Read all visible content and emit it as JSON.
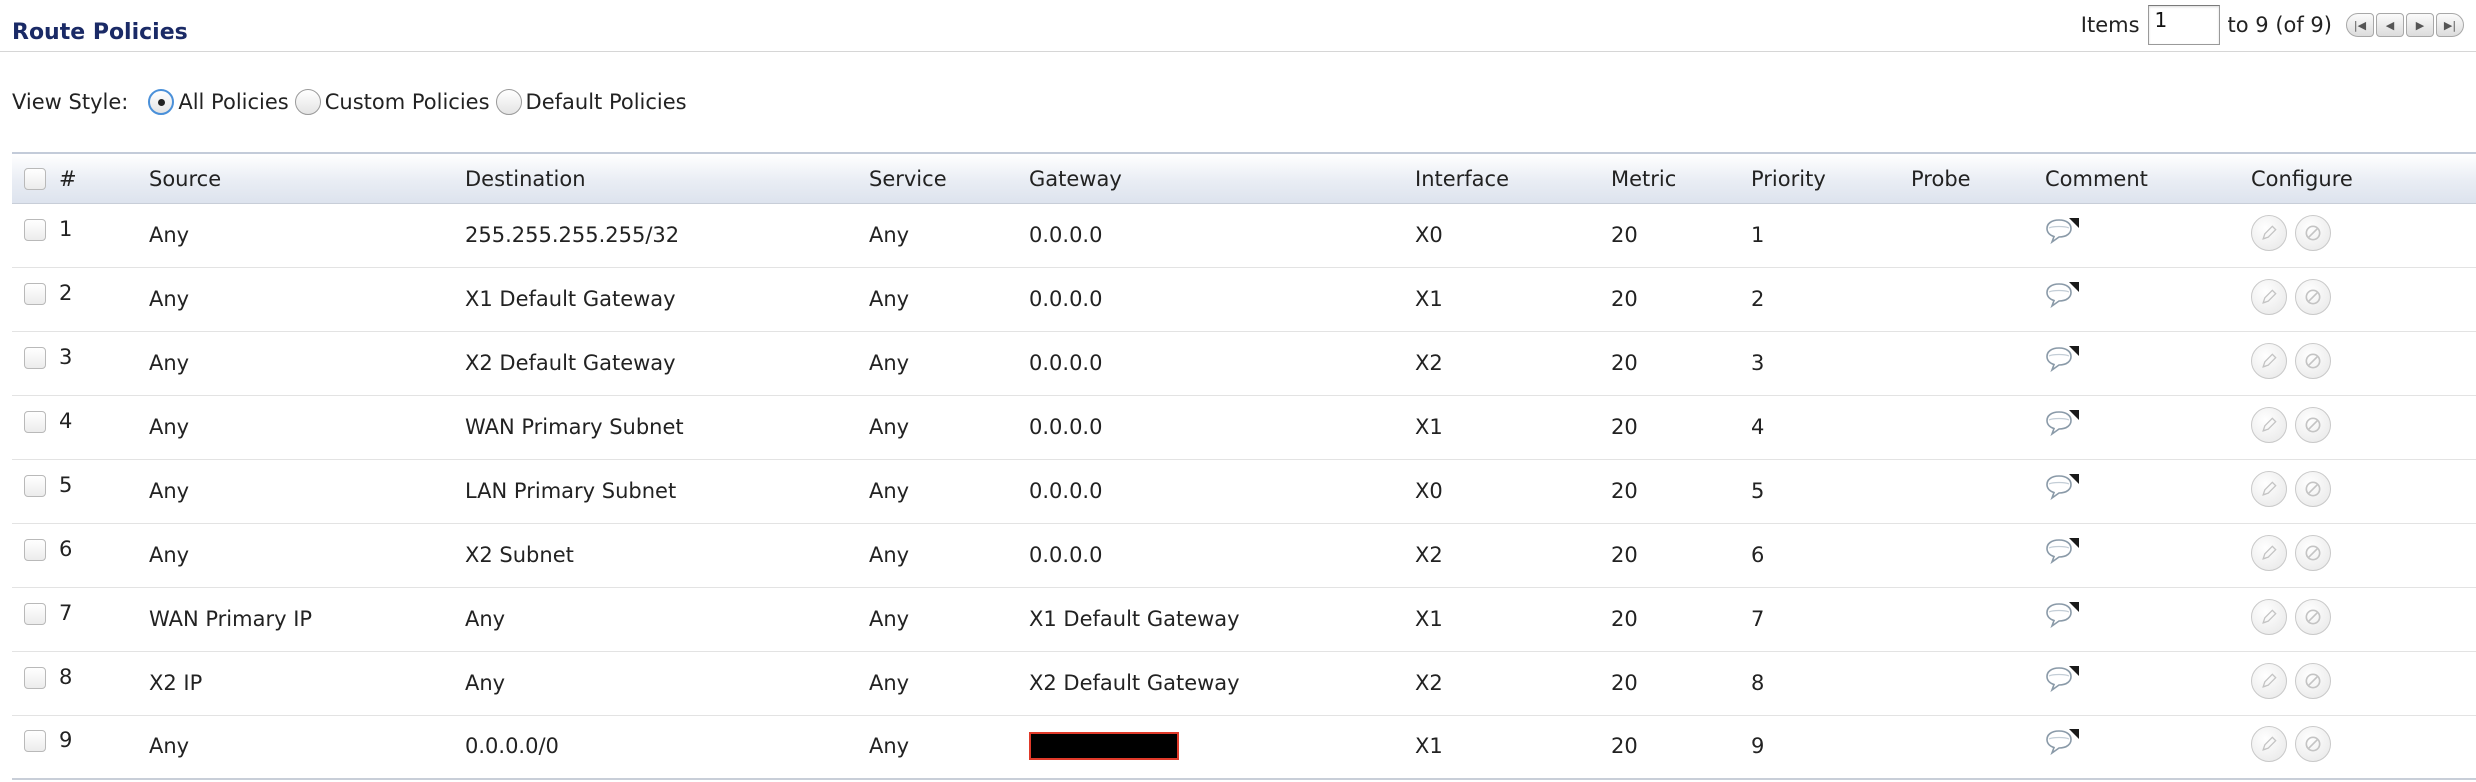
{
  "header": {
    "title": "Route Policies",
    "items_label": "Items",
    "items_value": "1",
    "range_text": "to 9 (of 9)"
  },
  "view_style": {
    "label": "View Style:",
    "options": [
      "All Policies",
      "Custom Policies",
      "Default Policies"
    ],
    "selected": "All Policies"
  },
  "table": {
    "columns": [
      "#",
      "Source",
      "Destination",
      "Service",
      "Gateway",
      "Interface",
      "Metric",
      "Priority",
      "Probe",
      "Comment",
      "Configure"
    ],
    "rows": [
      {
        "num": "1",
        "source": "Any",
        "destination": "255.255.255.255/32",
        "service": "Any",
        "gateway": "0.0.0.0",
        "interface": "X0",
        "metric": "20",
        "priority": "1",
        "probe": ""
      },
      {
        "num": "2",
        "source": "Any",
        "destination": "X1 Default Gateway",
        "service": "Any",
        "gateway": "0.0.0.0",
        "interface": "X1",
        "metric": "20",
        "priority": "2",
        "probe": ""
      },
      {
        "num": "3",
        "source": "Any",
        "destination": "X2 Default Gateway",
        "service": "Any",
        "gateway": "0.0.0.0",
        "interface": "X2",
        "metric": "20",
        "priority": "3",
        "probe": ""
      },
      {
        "num": "4",
        "source": "Any",
        "destination": "WAN Primary Subnet",
        "service": "Any",
        "gateway": "0.0.0.0",
        "interface": "X1",
        "metric": "20",
        "priority": "4",
        "probe": ""
      },
      {
        "num": "5",
        "source": "Any",
        "destination": "LAN Primary Subnet",
        "service": "Any",
        "gateway": "0.0.0.0",
        "interface": "X0",
        "metric": "20",
        "priority": "5",
        "probe": ""
      },
      {
        "num": "6",
        "source": "Any",
        "destination": "X2 Subnet",
        "service": "Any",
        "gateway": "0.0.0.0",
        "interface": "X2",
        "metric": "20",
        "priority": "6",
        "probe": ""
      },
      {
        "num": "7",
        "source": "WAN Primary IP",
        "destination": "Any",
        "service": "Any",
        "gateway": "X1 Default Gateway",
        "interface": "X1",
        "metric": "20",
        "priority": "7",
        "probe": ""
      },
      {
        "num": "8",
        "source": "X2 IP",
        "destination": "Any",
        "service": "Any",
        "gateway": "X2 Default Gateway",
        "interface": "X2",
        "metric": "20",
        "priority": "8",
        "probe": ""
      },
      {
        "num": "9",
        "source": "Any",
        "destination": "0.0.0.0/0",
        "service": "Any",
        "gateway": "",
        "gateway_redacted": true,
        "interface": "X1",
        "metric": "20",
        "priority": "9",
        "probe": ""
      }
    ]
  },
  "icons": {
    "pager": [
      "first-page-icon",
      "prev-page-icon",
      "next-page-icon",
      "last-page-icon"
    ],
    "comment": "comment-icon",
    "configure": [
      "edit-icon",
      "delete-icon"
    ]
  },
  "colors": {
    "title": "#1a2a66",
    "radio_selected": "#4a90d9",
    "redaction_border": "#e03a2a",
    "header_gradient_end": "#dde3ee"
  }
}
